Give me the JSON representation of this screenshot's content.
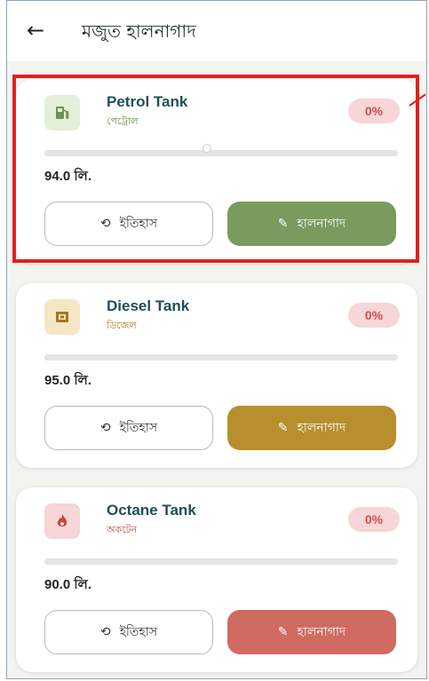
{
  "header": {
    "back_icon": "arrow-left-icon",
    "title": "মজুত হালনাগাদ"
  },
  "tanks": [
    {
      "name": "Petrol Tank",
      "subtitle": "পেট্রোল",
      "percent": "0%",
      "fill_fraction": 0,
      "quantity": "94.0 লি.",
      "icon": "fuel-pump-icon",
      "accent": "#7a9a5e",
      "icon_bg": "#e3efd9",
      "sub_color": "#5f8a3c",
      "history_label": "ইতিহাস",
      "update_label": "হালনাগাদ"
    },
    {
      "name": "Diesel Tank",
      "subtitle": "ডিজেল",
      "percent": "0%",
      "fill_fraction": 0,
      "quantity": "95.0 লি.",
      "icon": "diesel-can-icon",
      "accent": "#b78f2c",
      "icon_bg": "#f5e6c6",
      "sub_color": "#a07a1c",
      "history_label": "ইতিহাস",
      "update_label": "হালনাগাদ"
    },
    {
      "name": "Octane Tank",
      "subtitle": "অকটেন",
      "percent": "0%",
      "fill_fraction": 0,
      "quantity": "90.0 লি.",
      "icon": "flame-icon",
      "accent": "#cf6b61",
      "icon_bg": "#f6d6d6",
      "sub_color": "#c44a40",
      "history_label": "ইতিহাস",
      "update_label": "হালনাগাদ"
    }
  ],
  "highlight_color": "#e02020"
}
